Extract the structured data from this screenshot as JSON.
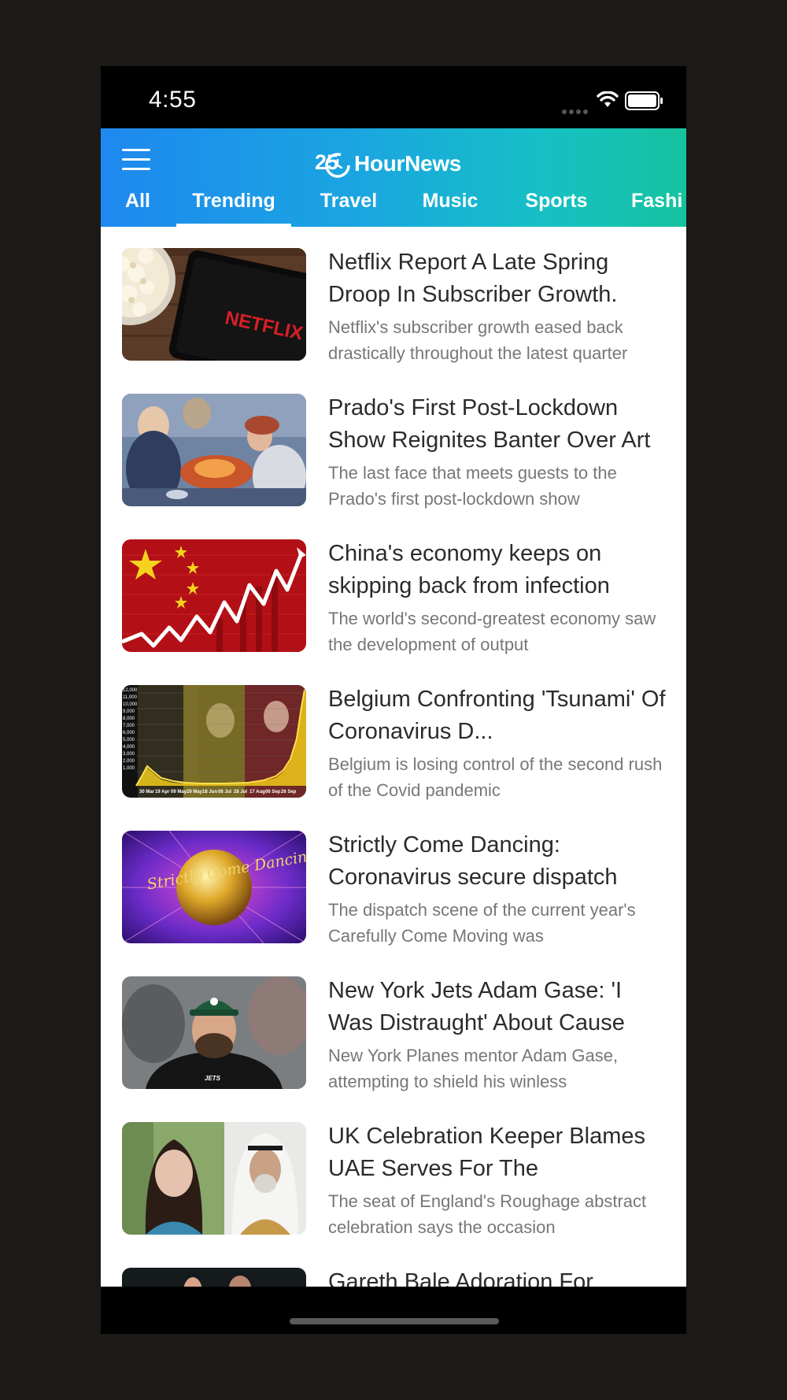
{
  "status_bar": {
    "time": "4:55"
  },
  "header": {
    "logo_number": "25",
    "logo_text": "HourNews",
    "tabs": [
      "All",
      "Trending",
      "Travel",
      "Music",
      "Sports",
      "Fashi"
    ],
    "active_tab": "Trending"
  },
  "colors": {
    "header_gradient_start": "#1e88ef",
    "header_gradient_end": "#15c39e",
    "title_text": "#2b2b2b",
    "desc_text": "#777777"
  },
  "articles": [
    {
      "title": "Netflix Report A Late Spring Droop In Subscriber Growth.",
      "desc": "Netflix's subscriber growth eased back drastically throughout the latest quarter",
      "image": "netflix-tablet-popcorn-image",
      "image_text": "NETFLIX"
    },
    {
      "title": "Prado's First Post-Lockdown Show Reignites Banter Over Art",
      "desc": "The last face that meets guests to the Prado's first post-lockdown show",
      "image": "painting-image"
    },
    {
      "title": "China's economy keeps on skipping back from infection",
      "desc": "The world's second-greatest economy saw the development of output",
      "image": "china-flag-chart-image"
    },
    {
      "title": "'Tsunami' Of Coronavirus Day Cases",
      "title_full": "Belgium Confronting 'Tsunami' Of Coronavirus D...",
      "desc": "Belgium is losing control of the second rush of the Covid pandemic",
      "image": "belgium-chart-image",
      "chart_y_ticks": [
        "1,000",
        "2,000",
        "3,000",
        "4,000",
        "5,000",
        "6,000",
        "7,000",
        "8,000",
        "9,000",
        "10,000",
        "11,000",
        "12,000"
      ],
      "chart_x_ticks": [
        "30 Mar",
        "19 Apr",
        "09 May",
        "29 May",
        "18 Jun",
        "08 Jul",
        "28 Jul",
        "17 Aug",
        "06 Sep",
        "26 Sep"
      ]
    },
    {
      "title": "Strictly Come Dancing: Coronavirus secure dispatch",
      "desc": "The dispatch scene of the current year's Carefully Come Moving was",
      "image": "strictly-logo-image",
      "image_text": "Strictly Come Dancing"
    },
    {
      "title": "New York Jets Adam Gase: 'I Was Distraught' About Cause",
      "desc": "New York Planes mentor Adam Gase, attempting to shield his winless",
      "image": "jets-coach-image",
      "image_text": "JETS"
    },
    {
      "title": "UK Celebration Keeper Blames UAE Serves For The",
      "desc": "The seat of England's Roughage abstract celebration says the occasion",
      "image": "two-people-image"
    },
    {
      "title": "Gareth Bale Adoration For",
      "desc": "",
      "image": "dark-photo-image"
    }
  ]
}
